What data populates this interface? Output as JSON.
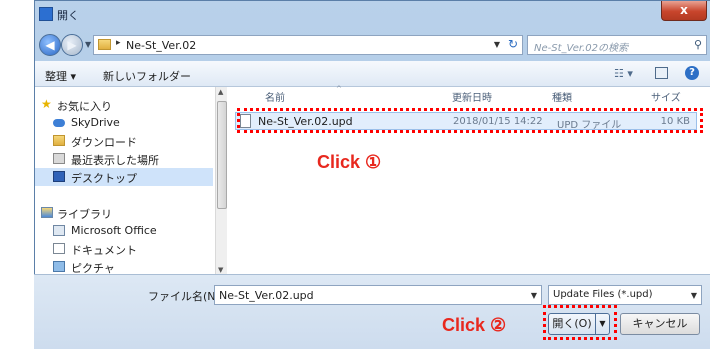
{
  "window": {
    "title": "開く",
    "close": "x"
  },
  "nav": {
    "back": "◀",
    "forward": "▶",
    "path": "Ne-St_Ver.02",
    "search_placeholder": "Ne-St_Ver.02の検索"
  },
  "toolbar": {
    "organize": "整理 ▾",
    "new_folder": "新しいフォルダー",
    "view": "☷ ▾",
    "help": "?"
  },
  "sidebar": {
    "items": [
      {
        "label": "お気に入り",
        "group": true,
        "icon": "star-icon"
      },
      {
        "label": "SkyDrive",
        "group": false,
        "icon": "cloud-icon"
      },
      {
        "label": "ダウンロード",
        "group": false,
        "icon": "download-icon"
      },
      {
        "label": "最近表示した場所",
        "group": false,
        "icon": "recent-places-icon"
      },
      {
        "label": "デスクトップ",
        "group": false,
        "icon": "desktop-icon",
        "selected": true
      },
      {
        "label": "ライブラリ",
        "group": true,
        "icon": "library-icon"
      },
      {
        "label": "Microsoft Office",
        "group": false,
        "icon": "office-icon"
      },
      {
        "label": "ドキュメント",
        "group": false,
        "icon": "document-icon"
      },
      {
        "label": "ピクチャ",
        "group": false,
        "icon": "picture-icon"
      }
    ]
  },
  "columns": {
    "name": "名前",
    "date": "更新日時",
    "type": "種類",
    "size": "サイズ"
  },
  "files": [
    {
      "name": "Ne-St_Ver.02.upd",
      "date": "2018/01/15 14:22",
      "type": "UPD ファイル",
      "size": "10 KB"
    }
  ],
  "annotations": {
    "click1": "Click ①",
    "click2": "Click ②"
  },
  "footer": {
    "filename_label": "ファイル名(N):",
    "filename_value": "Ne-St_Ver.02.upd",
    "filter_value": "Update Files (*.upd)",
    "open_label": "開く(O)",
    "cancel_label": "キャンセル"
  },
  "colors": {
    "annotation": "#e8281e",
    "selection": "#e2eefc"
  }
}
